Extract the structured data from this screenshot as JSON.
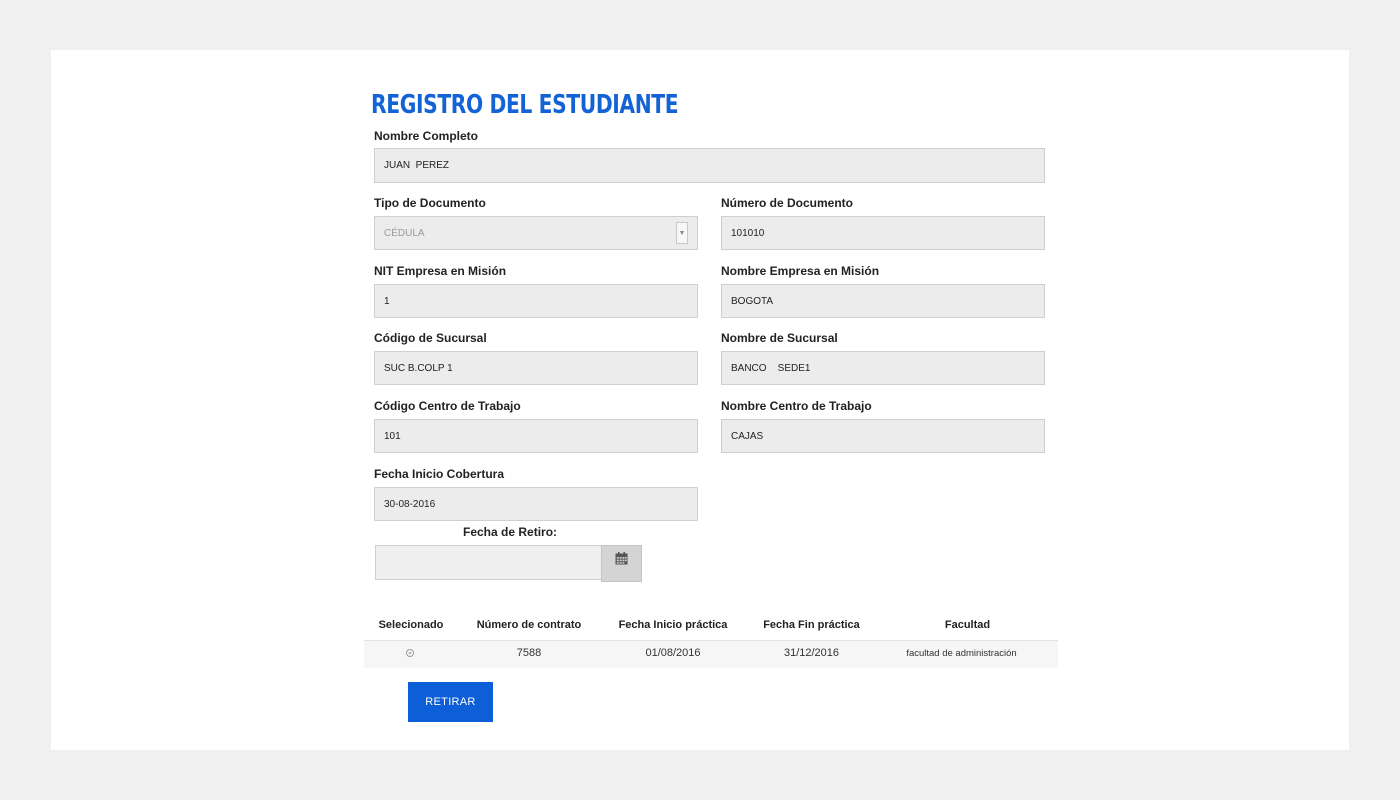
{
  "page": {
    "title": "REGISTRO DEL ESTUDIANTE"
  },
  "form": {
    "nombre_completo": {
      "label": "Nombre Completo",
      "value": "JUAN  PEREZ"
    },
    "tipo_documento": {
      "label": "Tipo de Documento",
      "value": "CÉDULA"
    },
    "numero_documento": {
      "label": "Número de Documento",
      "value": "101010"
    },
    "nit_empresa": {
      "label": "NIT Empresa en Misión",
      "value": "1"
    },
    "nombre_empresa": {
      "label": "Nombre Empresa en Misión",
      "value": "BOGOTA"
    },
    "codigo_sucursal": {
      "label": "Código de Sucursal",
      "value": "SUC B.COLP 1"
    },
    "nombre_sucursal": {
      "label": "Nombre de Sucursal",
      "value": "BANCO    SEDE1"
    },
    "codigo_centro": {
      "label": "Código Centro de Trabajo",
      "value": "101"
    },
    "nombre_centro": {
      "label": "Nombre Centro de Trabajo",
      "value": "CAJAS"
    },
    "fecha_inicio": {
      "label": "Fecha Inicio Cobertura",
      "value": "30-08-2016"
    },
    "fecha_retiro": {
      "label": "Fecha de Retiro:",
      "value": ""
    }
  },
  "table": {
    "headers": [
      "Selecionado",
      "Número de contrato",
      "Fecha Inicio práctica",
      "Fecha Fin práctica",
      "Facultad"
    ],
    "rows": [
      {
        "selected": false,
        "contrato": "7588",
        "inicio": "01/08/2016",
        "fin": "31/12/2016",
        "facultad": "facultad de administración"
      }
    ]
  },
  "actions": {
    "retirar_label": "RETIRAR"
  },
  "colors": {
    "accent": "#1463d6",
    "button": "#0c5fd6",
    "field_bg": "#ececec"
  },
  "icons": {
    "calendar": "calendar-icon",
    "select_caret": "chevron-down-icon"
  }
}
